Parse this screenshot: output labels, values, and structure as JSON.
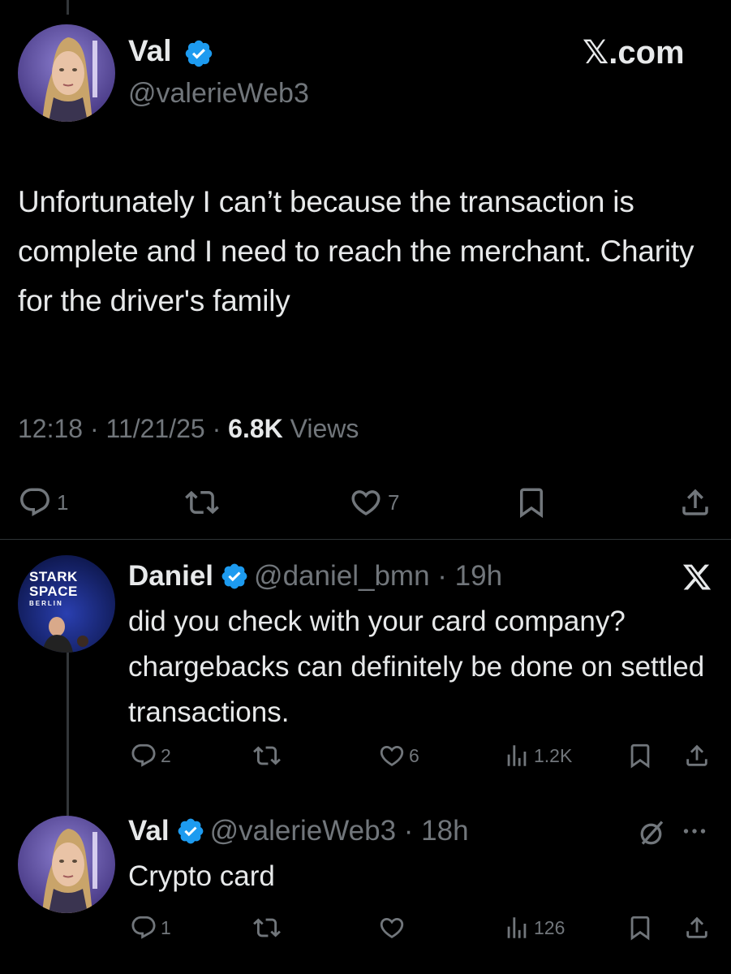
{
  "main_tweet": {
    "author_name": "Val",
    "handle": "@valerieWeb3",
    "site_label": "𝕏.com",
    "text": "Unfortunately I can’t because the transaction is complete and I need to reach the merchant. Charity for the driver's family",
    "time": "12:18 · 11/21/25 · ",
    "views_count": "6.8K",
    "views_label": " Views",
    "replies": "1",
    "likes": "7"
  },
  "reply_1": {
    "author_name": "Daniel",
    "handle_time": "@daniel_bmn · 19h",
    "avatar_text_1": "STARK",
    "avatar_text_2": "SPACE",
    "avatar_text_3": "BERLIN",
    "text": "did you check with your card company? chargebacks can definitely be done on settled transactions.",
    "replies": "2",
    "likes": "6",
    "views": "1.2K"
  },
  "reply_2": {
    "author_name": "Val",
    "handle_time": "@valerieWeb3 · 18h",
    "text": "Crypto card",
    "replies": "1",
    "views": "126"
  },
  "colors": {
    "background": "#000000",
    "text": "#e7e9ea",
    "secondary": "#71767b",
    "verified": "#1d9bf0",
    "divider": "#2f3336"
  },
  "icons": [
    "verified-badge-icon",
    "x-logo-icon",
    "reply-icon",
    "retweet-icon",
    "like-icon",
    "bookmark-icon",
    "share-icon",
    "views-icon",
    "grok-icon",
    "more-icon"
  ]
}
